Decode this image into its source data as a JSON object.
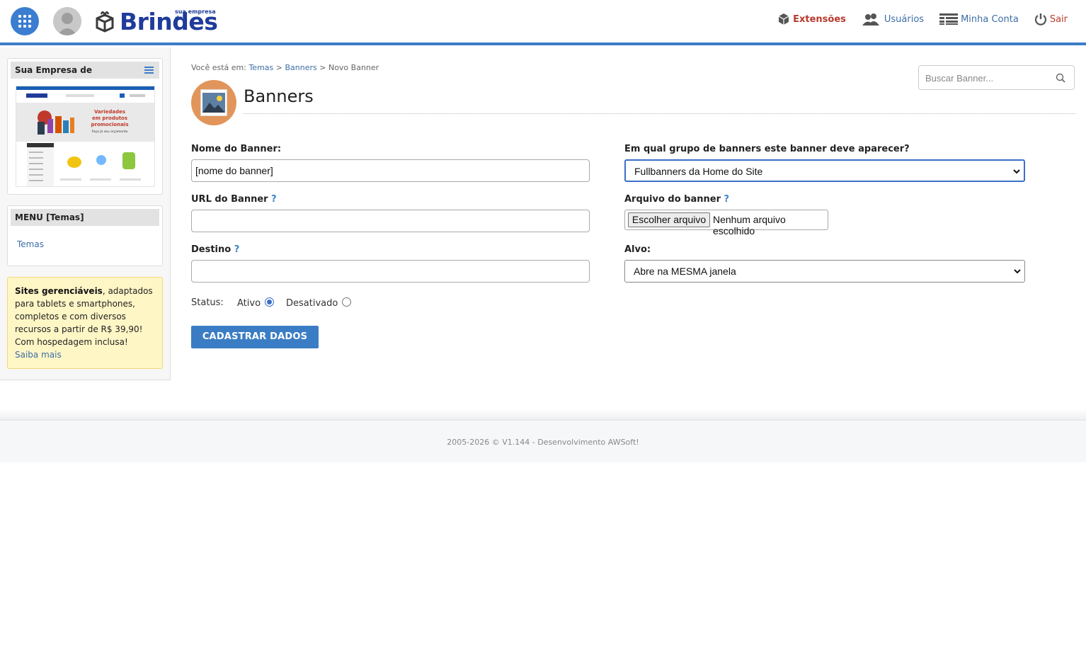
{
  "brand": {
    "name": "Brindes",
    "tagline": "sua empresa de"
  },
  "topnav": {
    "extensions": "Extensões",
    "users": "Usuários",
    "account": "Minha Conta",
    "exit": "Sair"
  },
  "sidebar": {
    "site_box": {
      "title": "Sua Empresa de"
    },
    "menu_box": {
      "title": "MENU [Temas]",
      "items": [
        "Temas"
      ]
    },
    "promo": {
      "bold": "Sites gerenciáveis",
      "text": ", adaptados para tablets e smartphones, completos e com diversos recursos a partir de R$ 39,90! Com hospedagem inclusa!",
      "link": "Saiba mais"
    }
  },
  "breadcrumb": {
    "prefix": "Você está em:",
    "items": [
      "Temas",
      "Banners"
    ],
    "current": "Novo Banner",
    "sep": ">"
  },
  "search": {
    "placeholder": "Buscar Banner..."
  },
  "page": {
    "title": "Banners"
  },
  "form": {
    "name_label": "Nome do Banner:",
    "name_value": "[nome do banner]",
    "url_label": "URL do Banner",
    "dest_label": "Destino",
    "help": "?",
    "group_label": "Em qual grupo de banners este banner deve aparecer?",
    "group_value": "Fullbanners da Home do Site",
    "file_label": "Arquivo do banner",
    "file_button": "Escolher arquivo",
    "file_none": "Nenhum arquivo escolhido",
    "target_label": "Alvo:",
    "target_value": "Abre na MESMA janela",
    "status_label": "Status:",
    "status_active": "Ativo",
    "status_inactive": "Desativado",
    "status_selected": "Ativo",
    "submit": "CADASTRAR DADOS"
  },
  "thumbnail": {
    "hero_lines": [
      "Variedades",
      "em produtos",
      "promocionais"
    ],
    "hero_sub": "Faça já seu orçamento"
  },
  "footer": {
    "text": "2005-2026 © V1.144 - Desenvolvimento AWSoft!"
  },
  "colors": {
    "accent": "#3d7cc9",
    "brand": "#1f3c9b",
    "promo_bg": "#fff6c6",
    "icon_circle": "#e2955a"
  }
}
